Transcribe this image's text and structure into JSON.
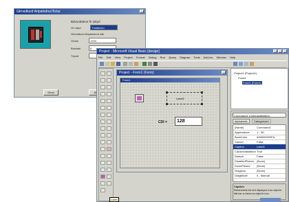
{
  "dialog": {
    "title": "Gtrnsdtuvd Artpalndnul Bctur",
    "heading": "Bdvuobdeon fn rpkyd",
    "label_1": "Gr relpd",
    "selected_value": "Tmtalecbu",
    "sub_label": "Gtrnsdtuvd Artpalndnul ndk",
    "fields": [
      {
        "label": "Grdon",
        "value": "1200"
      },
      {
        "label": "Bordaal",
        "value": "8"
      },
      {
        "label": "Tvpod",
        "value": ""
      }
    ],
    "buttons": [
      "Gtnul",
      "Aldr",
      "Bdtnol"
    ]
  },
  "ide": {
    "title": "Project - Microsoft Visual Basic [design]",
    "menu": [
      "File",
      "Edit",
      "View",
      "Project",
      "Format",
      "Debug",
      "Run",
      "Query",
      "Diagram",
      "Tools",
      "Add-Ins",
      "Window",
      "Help"
    ],
    "toolbox_tooltip": "Label"
  },
  "form_designer": {
    "title": "Project - Form1 (Form)",
    "form_title": "Form1",
    "label_caption": "Label1",
    "text_label": "CDI =",
    "text_value": "128"
  },
  "project_explorer": {
    "items": [
      "Project1 (Project1)",
      "Forms",
      "Form1 (Form1)"
    ]
  },
  "properties": {
    "object": "Command1 CommandButton",
    "tabs": [
      "Alphabetic",
      "Categorized"
    ],
    "rows": [
      {
        "name": "(Name)",
        "value": "Command1"
      },
      {
        "name": "Appearance",
        "value": "1 - 3D"
      },
      {
        "name": "BackColor",
        "value": "&H8000000F&"
      },
      {
        "name": "Cancel",
        "value": "False"
      },
      {
        "name": "Caption",
        "value": "Label1"
      },
      {
        "name": "CausesValidation",
        "value": "True"
      },
      {
        "name": "Default",
        "value": "False"
      },
      {
        "name": "DisabledPicture",
        "value": "(None)"
      },
      {
        "name": "DownPicture",
        "value": "(None)"
      },
      {
        "name": "DragIcon",
        "value": "(None)"
      },
      {
        "name": "DragMode",
        "value": "0 - Manual"
      }
    ],
    "footer_title": "Caption",
    "footer_text": "Returns/sets the text displayed in an object's title bar or below an object's icon."
  },
  "colors": {
    "titlebar_start": "#1c3c8c",
    "titlebar_end": "#6c8cc4",
    "window_face": "#d4d4cc",
    "field_highlight": "#1c3c8c",
    "preview_bg": "#1aa0a8",
    "icon_red": "#c8302c",
    "form_icon": "#c85cb8"
  }
}
